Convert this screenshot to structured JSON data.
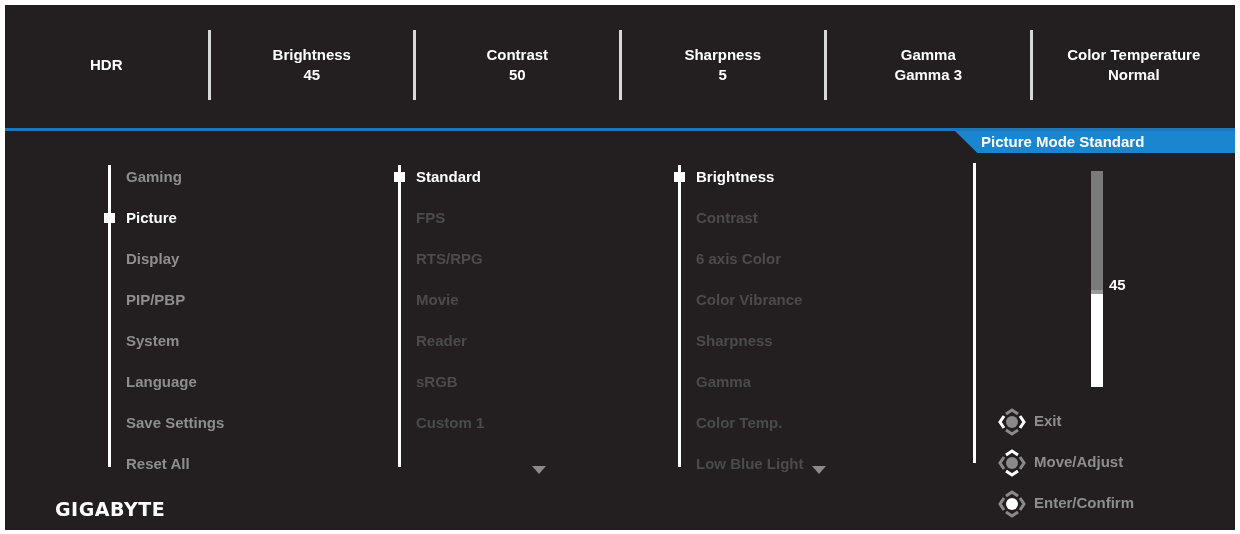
{
  "top_bar": [
    {
      "label": "HDR"
    },
    {
      "label": "Brightness",
      "value": "45"
    },
    {
      "label": "Contrast",
      "value": "50"
    },
    {
      "label": "Sharpness",
      "value": "5"
    },
    {
      "label": "Gamma",
      "value": "Gamma 3"
    },
    {
      "label": "Color Temperature",
      "value": "Normal"
    }
  ],
  "mode_banner": "Picture Mode Standard",
  "main_menu": [
    {
      "label": "Gaming",
      "selected": false
    },
    {
      "label": "Picture",
      "selected": true
    },
    {
      "label": "Display",
      "selected": false
    },
    {
      "label": "PIP/PBP",
      "selected": false
    },
    {
      "label": "System",
      "selected": false
    },
    {
      "label": "Language",
      "selected": false
    },
    {
      "label": "Save Settings",
      "selected": false
    },
    {
      "label": "Reset All",
      "selected": false
    }
  ],
  "picture_modes": [
    {
      "label": "Standard",
      "selected": true
    },
    {
      "label": "FPS",
      "selected": false
    },
    {
      "label": "RTS/RPG",
      "selected": false
    },
    {
      "label": "Movie",
      "selected": false
    },
    {
      "label": "Reader",
      "selected": false
    },
    {
      "label": "sRGB",
      "selected": false
    },
    {
      "label": "Custom 1",
      "selected": false
    }
  ],
  "settings": [
    {
      "label": "Brightness",
      "selected": true
    },
    {
      "label": "Contrast",
      "selected": false
    },
    {
      "label": "6 axis Color",
      "selected": false
    },
    {
      "label": "Color Vibrance",
      "selected": false
    },
    {
      "label": "Sharpness",
      "selected": false
    },
    {
      "label": "Gamma",
      "selected": false
    },
    {
      "label": "Color Temp.",
      "selected": false
    },
    {
      "label": "Low Blue Light",
      "selected": false
    }
  ],
  "slider": {
    "level": 0.45,
    "reading": "45"
  },
  "legend": [
    {
      "kind": "exit",
      "label": "Exit"
    },
    {
      "kind": "move",
      "label": "Move/Adjust"
    },
    {
      "kind": "enter",
      "label": "Enter/Confirm"
    }
  ],
  "logo": "GIGABYTE"
}
